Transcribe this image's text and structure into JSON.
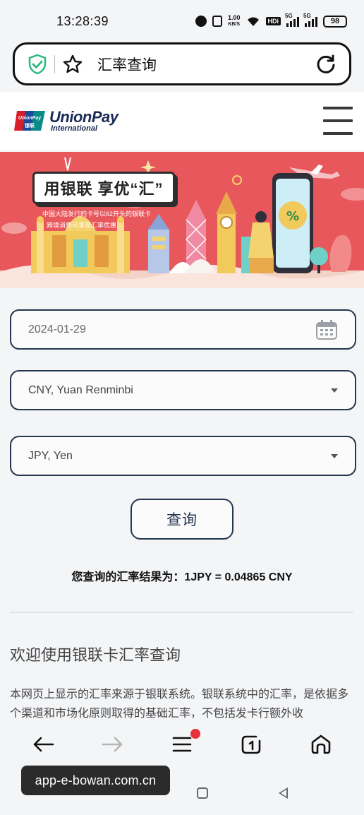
{
  "status_bar": {
    "time": "13:28:39",
    "net_speed_top": "1.00",
    "net_speed_unit": "KB/S",
    "hd_label": "HDi",
    "sig1_label": "5G",
    "sig2_label": "5G",
    "battery": "98"
  },
  "address_bar": {
    "title": "汇率查询"
  },
  "site": {
    "logo_top": "UnionPay",
    "logo_bottom": "International",
    "logo_mark_cn": "银联",
    "logo_mark_en": "UnionPay"
  },
  "banner": {
    "title": "用银联  享优“汇”",
    "line1": "中国大陆发行的卡号以62开头的银联卡",
    "line2": "跨境消费可享受汇率优惠"
  },
  "form": {
    "date_value": "2024-01-29",
    "from_currency": "CNY, Yuan Renminbi",
    "to_currency": "JPY, Yen",
    "query_label": "查询"
  },
  "result": {
    "text": "您查询的汇率结果为：1JPY = 0.04865 CNY"
  },
  "content": {
    "welcome_title": "欢迎使用银联卡汇率查询",
    "description": "本网页上显示的汇率来源于银联系统。银联系统中的汇率，是依据多个渠道和市场化原则取得的基础汇率，不包括发卡行额外收"
  },
  "watermark": {
    "text": "app-e-bowan.com.cn"
  },
  "colors": {
    "banner_bg": "#e8575c",
    "field_border": "#24374f",
    "notification_dot": "#e8303a",
    "shield_green": "#2db87a"
  }
}
